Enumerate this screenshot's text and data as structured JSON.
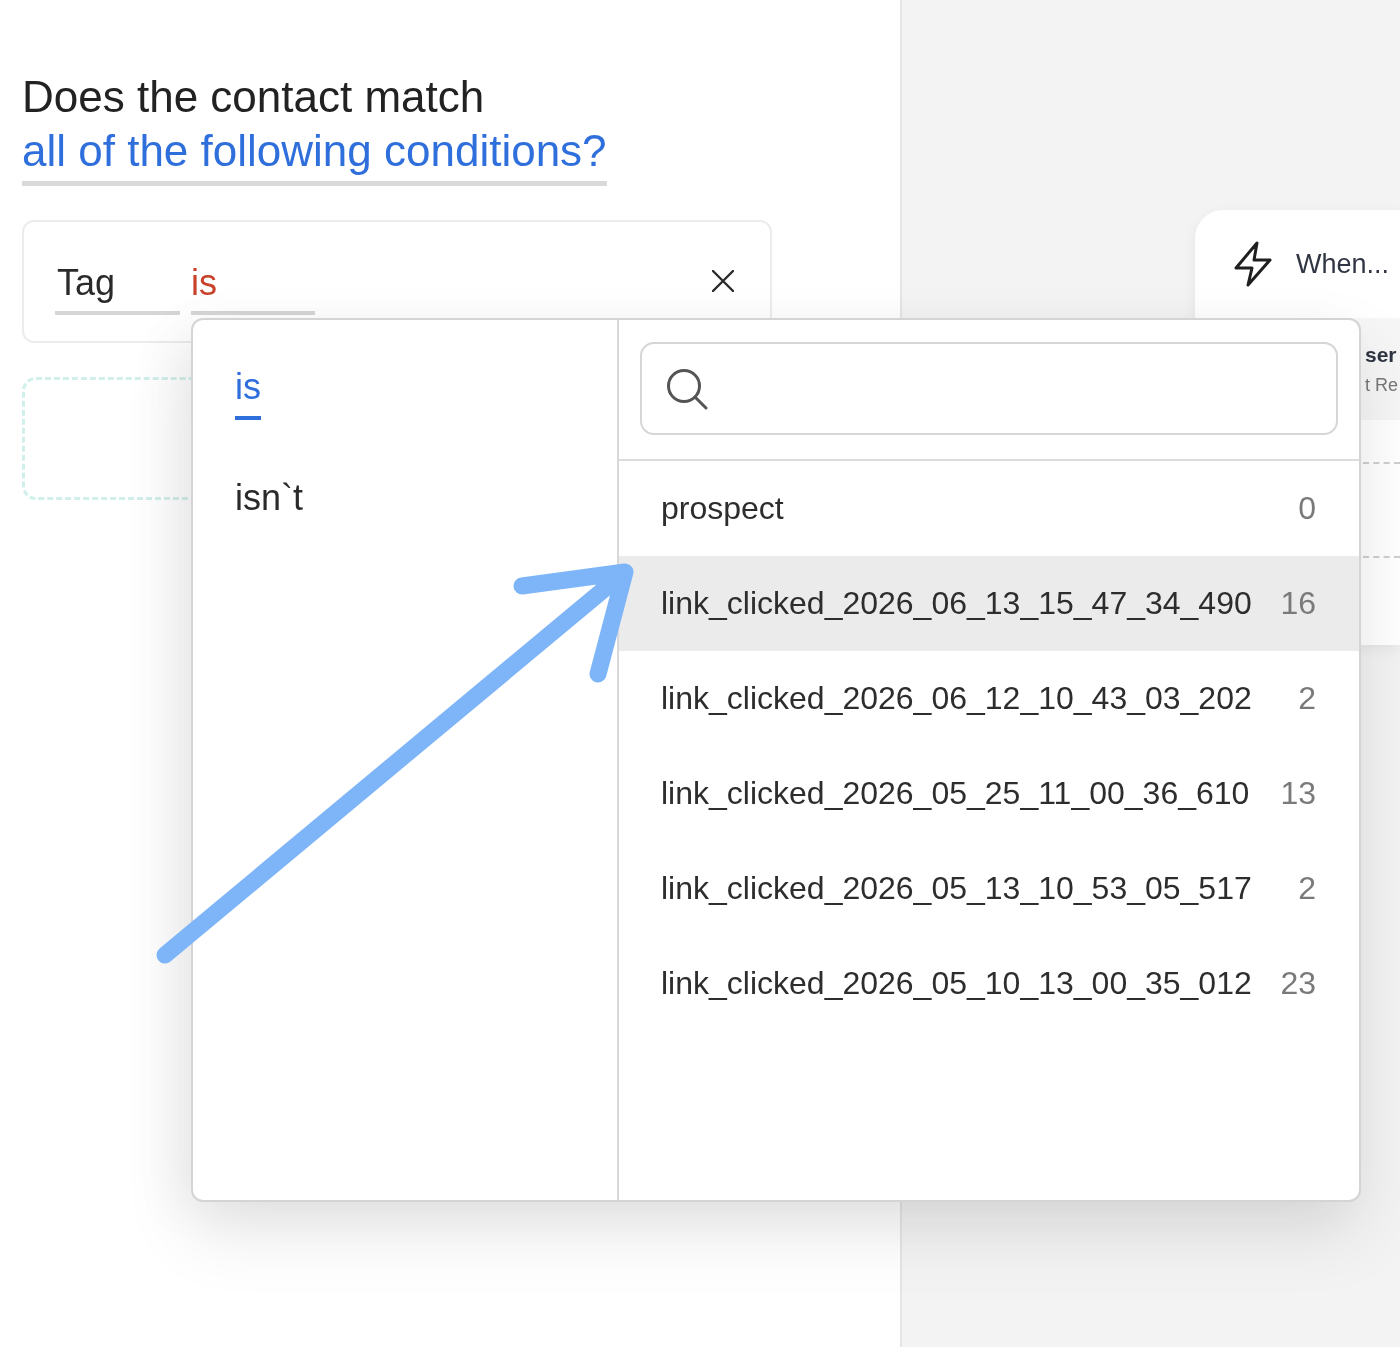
{
  "question": {
    "text": "Does the contact match",
    "match_mode": "all of the following conditions?"
  },
  "condition": {
    "field": "Tag",
    "operator": "is"
  },
  "operator_menu": {
    "options": [
      {
        "label": "is",
        "selected": true
      },
      {
        "label": "isn`t",
        "selected": false
      }
    ]
  },
  "tag_menu": {
    "items": [
      {
        "name": "prospect",
        "count": "0",
        "highlighted": false
      },
      {
        "name": "link_clicked_2026_06_13_15_47_34_490",
        "count": "16",
        "highlighted": true
      },
      {
        "name": "link_clicked_2026_06_12_10_43_03_202",
        "count": "2",
        "highlighted": false
      },
      {
        "name": "link_clicked_2026_05_25_11_00_36_610",
        "count": "13",
        "highlighted": false
      },
      {
        "name": "link_clicked_2026_05_13_10_53_05_517",
        "count": "2",
        "highlighted": false
      },
      {
        "name": "link_clicked_2026_05_10_13_00_35_012",
        "count": "23",
        "highlighted": false
      }
    ]
  },
  "trigger_card": {
    "title": "When...",
    "heading": "ser",
    "subtitle": "t Re"
  }
}
